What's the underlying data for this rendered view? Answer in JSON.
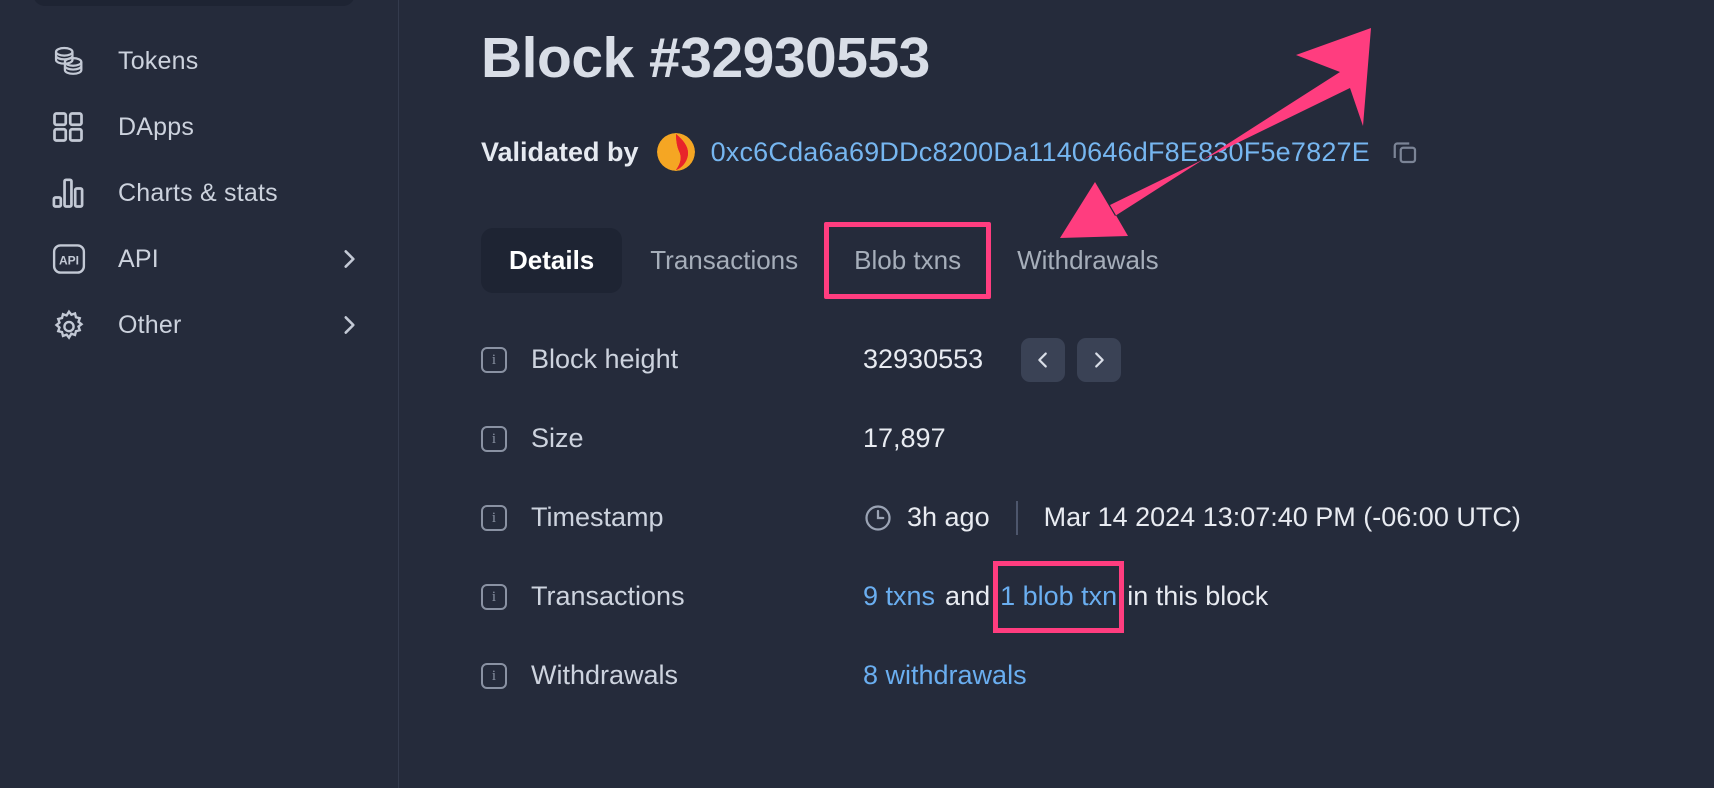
{
  "sidebar": {
    "items": [
      {
        "label": "Tokens",
        "icon": "coins-stack-icon",
        "chevron": false
      },
      {
        "label": "DApps",
        "icon": "grid-squares-icon",
        "chevron": false
      },
      {
        "label": "Charts & stats",
        "icon": "bar-chart-icon",
        "chevron": false
      },
      {
        "label": "API",
        "icon": "api-badge-icon",
        "chevron": true
      },
      {
        "label": "Other",
        "icon": "gear-icon",
        "chevron": true
      }
    ]
  },
  "header": {
    "title": "Block #32930553",
    "validated_by_label": "Validated by",
    "validator_address": "0xc6Cda6a69DDc8200Da1140646dF8E830F5e7827E",
    "copy_icon": "copy-icon",
    "validator_logo": "validator-logo-icon"
  },
  "tabs": [
    {
      "label": "Details",
      "active": true,
      "highlighted": false
    },
    {
      "label": "Transactions",
      "active": false,
      "highlighted": false
    },
    {
      "label": "Blob txns",
      "active": false,
      "highlighted": true
    },
    {
      "label": "Withdrawals",
      "active": false,
      "highlighted": false
    }
  ],
  "details": {
    "block_height": {
      "label": "Block height",
      "value": "32930553",
      "prev_label": "‹",
      "next_label": "›"
    },
    "size": {
      "label": "Size",
      "value": "17,897"
    },
    "timestamp": {
      "label": "Timestamp",
      "relative": "3h ago",
      "absolute": "Mar 14 2024 13:07:40 PM (-06:00 UTC)",
      "clock_icon": "clock-icon"
    },
    "transactions": {
      "label": "Transactions",
      "txns_link": "9 txns",
      "and_text": "and",
      "blob_link": "1 blob txn",
      "suffix_text": "in this block"
    },
    "withdrawals": {
      "label": "Withdrawals",
      "value": "8 withdrawals"
    }
  },
  "annotations": {
    "highlight_color": "#ff3d7f",
    "arrow": "pink-annotation-arrow"
  },
  "colors": {
    "background": "#252b3b",
    "sidebar": "#252b3b",
    "link": "#6aaef0",
    "accent_pink": "#ff3d7f",
    "active_tab_bg": "#1e2433"
  }
}
